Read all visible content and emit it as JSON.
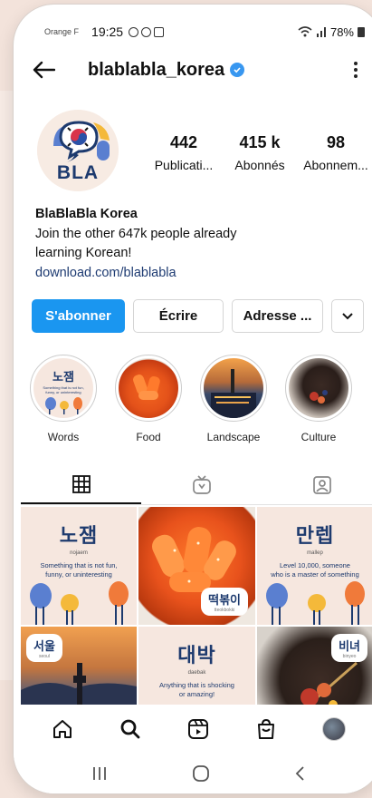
{
  "status_bar": {
    "carrier": "Orange F",
    "time": "19:25",
    "battery": "78%"
  },
  "header": {
    "username": "blablabla_korea"
  },
  "profile": {
    "avatar_text": "BLA",
    "stats": [
      {
        "value": "442",
        "label": "Publicati..."
      },
      {
        "value": "415 k",
        "label": "Abonnés"
      },
      {
        "value": "98",
        "label": "Abonnem..."
      }
    ],
    "bio": {
      "name": "BlaBlaBla Korea",
      "line1": "Join the other 647k people already",
      "line2": "learning Korean!",
      "link": "download.com/blablabla"
    }
  },
  "actions": {
    "follow": "S'abonner",
    "message": "Écrire",
    "address": "Adresse ..."
  },
  "highlights": [
    {
      "label": "Words",
      "word": "노잼",
      "def": "Something that is not fun, funny, or uninteresting"
    },
    {
      "label": "Food"
    },
    {
      "label": "Landscape"
    },
    {
      "label": "Culture"
    }
  ],
  "grid": {
    "cell1": {
      "word": "노잼",
      "rom": "nojaem",
      "def1": "Something that is not fun,",
      "def2": "funny, or uninteresting"
    },
    "cell2": {
      "label": "떡볶이",
      "rom": "tteokbokki"
    },
    "cell3": {
      "word": "만렙",
      "rom": "mallep",
      "def1": "Level 10,000, someone",
      "def2": "who is a master of something"
    },
    "cell4": {
      "label": "서울",
      "rom": "seoul"
    },
    "cell5": {
      "word": "대박",
      "rom": "daebak",
      "def1": "Anything that is shocking",
      "def2": "or amazing!"
    },
    "cell6": {
      "label": "비녀",
      "rom": "binyeo"
    }
  },
  "colors": {
    "primary": "#1a96f0",
    "navy": "#1d3a6e",
    "peach": "#f6e7df",
    "orange": "#f07a3a",
    "blue": "#5a7fd0",
    "yellow": "#f4b93a"
  }
}
